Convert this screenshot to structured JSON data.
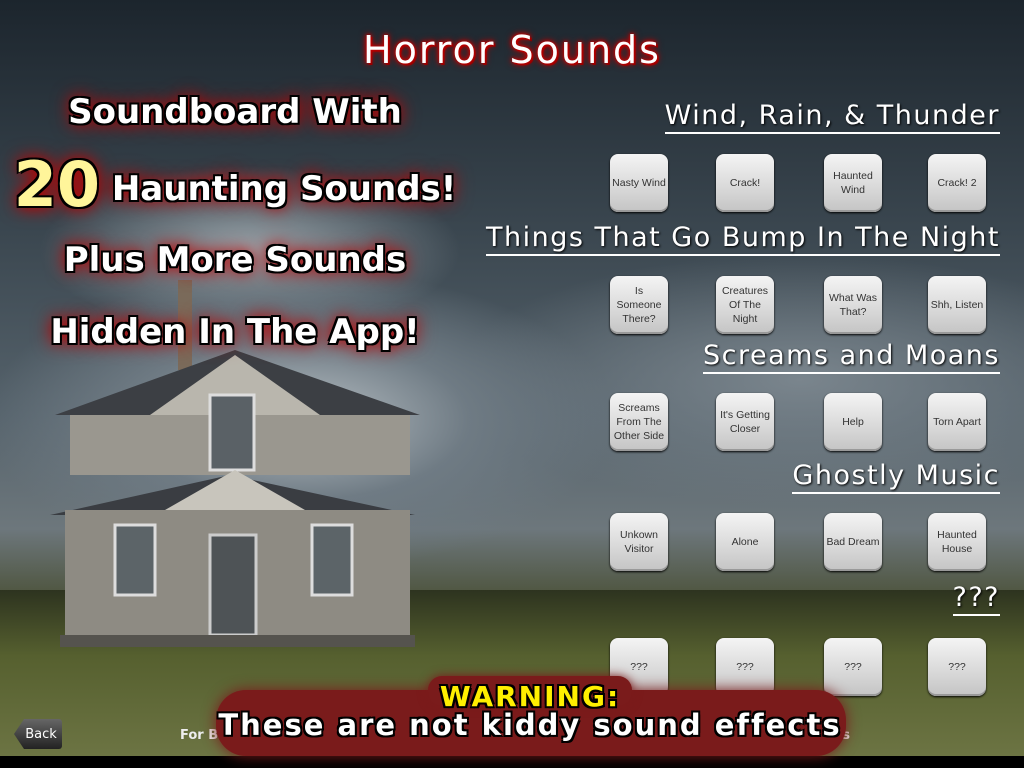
{
  "title": "Horror Sounds",
  "promo": {
    "line1": "Soundboard With",
    "count": "20",
    "line2": "Haunting Sounds!",
    "line3": "Plus More Sounds",
    "line4": "Hidden In The App!"
  },
  "sections": [
    {
      "title": "Wind, Rain, & Thunder",
      "buttons": [
        "Nasty Wind",
        "Crack!",
        "Haunted Wind",
        "Crack! 2"
      ]
    },
    {
      "title": "Things That Go Bump In The Night",
      "buttons": [
        "Is Someone There?",
        "Creatures Of The Night",
        "What Was That?",
        "Shh, Listen"
      ]
    },
    {
      "title": "Screams and Moans",
      "buttons": [
        "Screams From The Other Side",
        "It's Getting Closer",
        "Help",
        "Torn Apart"
      ]
    },
    {
      "title": "Ghostly Music",
      "buttons": [
        "Unkown Visitor",
        "Alone",
        "Bad Dream",
        "Haunted House"
      ]
    },
    {
      "title": "???",
      "buttons": [
        "???",
        "???",
        "???",
        "???"
      ]
    }
  ],
  "back_label": "Back",
  "footnote": {
    "start": "For Be",
    "end": "vels"
  },
  "warning": {
    "label": "WARNING:",
    "text": "These are not kiddy sound effects"
  },
  "colors": {
    "title_glow": "#cc0000",
    "warning": "#ffef00",
    "count": "#fff59a"
  }
}
